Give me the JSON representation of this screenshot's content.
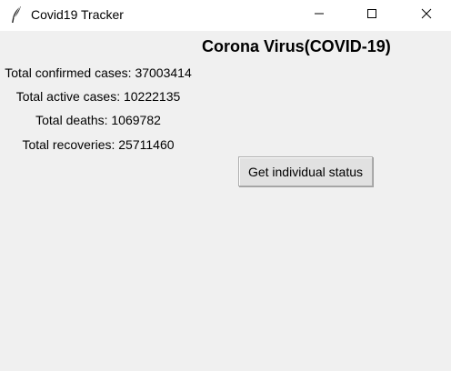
{
  "window": {
    "title": "Covid19 Tracker",
    "app_icon": "feather-icon",
    "controls": {
      "minimize_icon": "minimize-icon",
      "maximize_icon": "maximize-icon",
      "close_icon": "close-icon"
    }
  },
  "main": {
    "heading": "Corona Virus(COVID-19)",
    "stats": {
      "confirmed": "Total confirmed cases: 37003414",
      "active": "Total active cases: 10222135",
      "deaths": "Total deaths: 1069782",
      "recoveries": "Total recoveries: 25711460"
    },
    "button_label": "Get individual status"
  },
  "colors": {
    "background": "#f0f0f0",
    "titlebar": "#ffffff",
    "button_face": "#e1e1e1",
    "button_border": "#adadad"
  }
}
